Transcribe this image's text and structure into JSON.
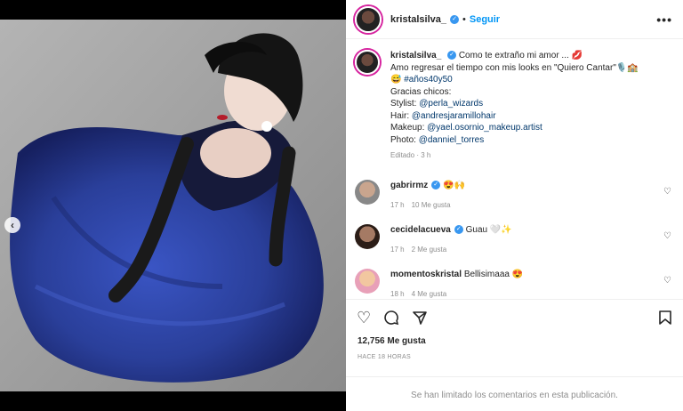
{
  "post": {
    "username": "kristalsilva_",
    "separator": "•",
    "follow_label": "Seguir",
    "more_label": "•••",
    "prev_label": "‹",
    "carousel_slides": 3,
    "carousel_active": 3
  },
  "caption": {
    "username": "kristalsilva_",
    "line1": "Como te extraño mi amor ... 💋",
    "line2": "Amo regresar el tiempo con mis looks en \"Quiero Cantar\"🎙️🏫",
    "line3_emoji": "😅 ",
    "hashtag": "#años40y50",
    "line4": "Gracias chicos:",
    "stylist_label": "Stylist: ",
    "stylist": "@perla_wizards",
    "hair_label": "Hair: ",
    "hair": "@andresjaramillohair",
    "makeup_label": "Makeup: ",
    "makeup": "@yael.osornio_makeup.artist",
    "photo_label": "Photo: ",
    "photo": "@danniel_torres",
    "edited": "Editado · 3 h"
  },
  "comments": [
    {
      "username": "gabrirmz",
      "text": "😍🙌",
      "time": "17 h",
      "likes": "10 Me gusta"
    },
    {
      "username": "cecidelacueva",
      "text": "Guau 🤍✨",
      "time": "17 h",
      "likes": "2 Me gusta"
    },
    {
      "username": "momentoskristal",
      "text": "Bellisimaaa 😍",
      "time": "18 h",
      "likes": "4 Me gusta"
    }
  ],
  "stats": {
    "likes": "12,756 Me gusta",
    "posted": "HACE 18 HORAS"
  },
  "footer": {
    "limited": "Se han limitado los comentarios en esta publicación."
  },
  "colors": {
    "link": "#00376b",
    "follow": "#0095f6",
    "gown": "#2a3f9a",
    "verified": "#3897f0"
  }
}
